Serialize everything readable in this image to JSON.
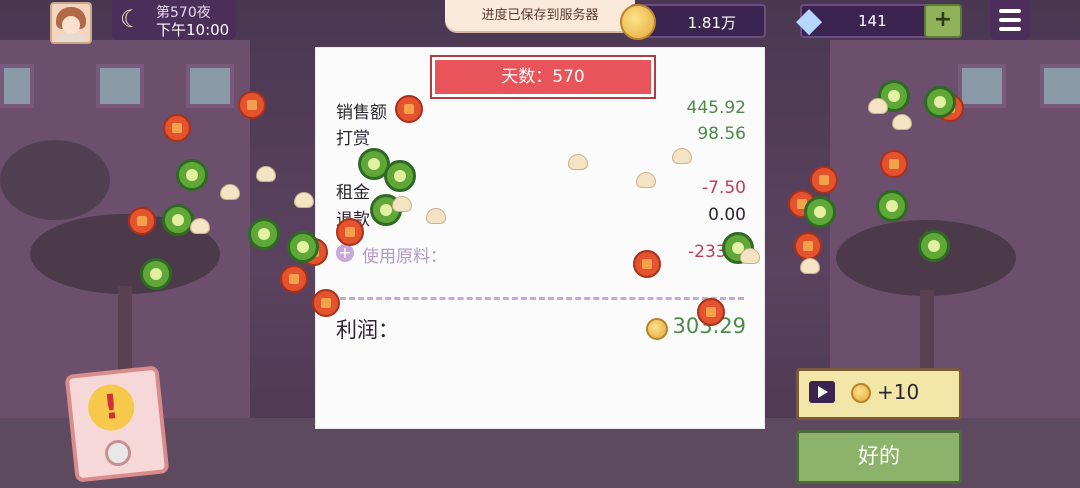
{
  "header": {
    "night_label": "第570夜",
    "time_label": "下午10:00",
    "toast": "进度已保存到服务器",
    "coins": "1.81万",
    "gems": "141",
    "gem_plus": "+"
  },
  "receipt": {
    "day_label": "天数：570",
    "rows": [
      {
        "label": "销售额",
        "value": "445.92"
      },
      {
        "label": "打赏",
        "value": "98.56"
      },
      {
        "label": "租金",
        "value": "-7.50"
      },
      {
        "label": "退款",
        "value": "0.00"
      },
      {
        "label": "使用原料：",
        "value": "-233."
      }
    ],
    "profit_label": "利润：",
    "profit_value": "303.29"
  },
  "buttons": {
    "ad_reward": "+10",
    "ok": "好的"
  },
  "icons": {
    "moon": "moon-icon",
    "coin": "coin-icon",
    "gem": "diamond-icon",
    "menu": "hamburger-menu-icon",
    "alert": "exclamation-icon",
    "play": "video-play-icon",
    "add": "plus-circle-icon"
  },
  "colors": {
    "positive": "#4d8a4a",
    "negative": "#c13b52",
    "ribbon": "#e8545a",
    "ok_button": "#8bb46a"
  }
}
